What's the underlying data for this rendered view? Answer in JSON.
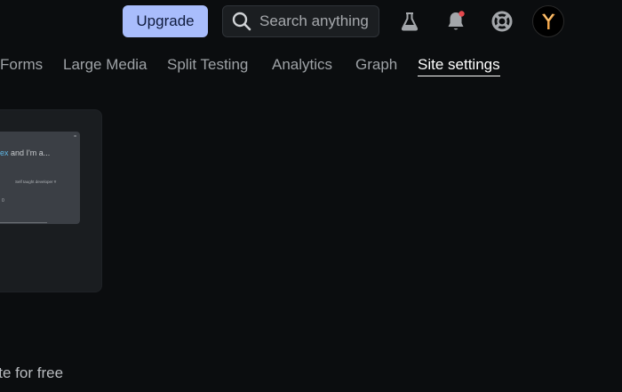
{
  "header": {
    "upgrade_label": "Upgrade",
    "search_placeholder": "Search anything",
    "notification_dot_color": "#e5484d",
    "accent_color": "#a9bdfc"
  },
  "nav": {
    "items": [
      {
        "label": "Forms"
      },
      {
        "label": "Large Media"
      },
      {
        "label": "Split Testing"
      },
      {
        "label": "Analytics"
      },
      {
        "label": "Graph"
      },
      {
        "label": "Site settings",
        "active": true
      }
    ]
  },
  "preview": {
    "headline_accent": "ex",
    "headline_rest": " and I'm a...",
    "subtext": "Self taught developer #",
    "stat": "0",
    "corner_mark": "="
  },
  "footer": {
    "text": "site for free"
  },
  "icons": {
    "search": "search-icon",
    "labs": "flask-icon",
    "notifications": "bell-icon",
    "help": "lifebuoy-icon",
    "avatar": "user-avatar"
  }
}
